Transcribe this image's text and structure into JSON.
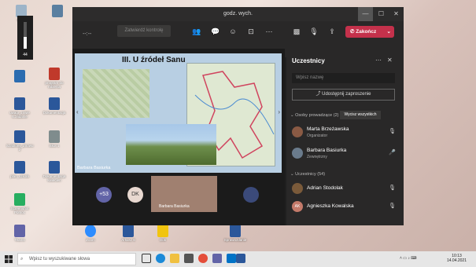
{
  "desktop": {
    "icons": [
      {
        "label": "",
        "color": "#5a7fa0"
      },
      {
        "label": "Kosz",
        "color": "#9db4c8"
      },
      {
        "label": "",
        "color": "#2b6cb0"
      },
      {
        "label": "program do robienia",
        "color": "#c0392b"
      },
      {
        "label": "uwagi_znwie 6.zadanie",
        "color": "#2b579a"
      },
      {
        "label": "Dokumentacja",
        "color": "#2b579a"
      },
      {
        "label": "Szablony_Znowu 2",
        "color": "#2b579a"
      },
      {
        "label": "Skot 1",
        "color": "#7f8c8d"
      },
      {
        "label": "plan_szkola",
        "color": "#2b579a"
      },
      {
        "label": "Dokumentacja kwiecien",
        "color": "#2b579a"
      },
      {
        "label": "Screenshot Pomoc",
        "color": "#27ae60"
      },
      {
        "label": "Zoom",
        "color": "#2d8cff"
      },
      {
        "label": "Teams",
        "color": "#6264a7"
      },
      {
        "label": "Arkusz 6",
        "color": "#2b579a"
      },
      {
        "label": "Dok",
        "color": "#f1c40f"
      },
      {
        "label": "Sprawozdanie",
        "color": "#2b579a"
      }
    ]
  },
  "window": {
    "title": "godz. wych.",
    "minimize": "—",
    "maximize": "☐",
    "close": "✕"
  },
  "toolbar": {
    "timer": "--:--",
    "admit_label": "Zatwierdź kontrolę",
    "leave_label": "Zakończ"
  },
  "slide": {
    "title": "III. U źródeł Sanu",
    "presenter": "Barbara Basiurka"
  },
  "thumbs": {
    "overflow": "+53",
    "initials": "DK",
    "cam_name": "Barbara Basiurka"
  },
  "panel": {
    "title": "Uczestnicy",
    "search_placeholder": "Wpisz nazwę",
    "share_label": "Udostępnij zaproszenie",
    "presenters_header": "Osoby prowadzące (2)",
    "mute_all": "Wycisz wszystkich",
    "attendees_header": "Uczestnicy (54)",
    "presenters": [
      {
        "name": "Marta Brzeżawska",
        "role": "Organizator",
        "color": "#8a5a44"
      },
      {
        "name": "Barbara Basiurka",
        "role": "Zewnętrzny",
        "color": "#6a7b8c"
      }
    ],
    "attendees": [
      {
        "name": "Adrian Stodolak",
        "role": "",
        "color": "#7a5a3a"
      },
      {
        "name": "Agnieszka Kowalska",
        "role": "",
        "color": "#c47a6a",
        "initials": "AK"
      }
    ]
  },
  "taskbar": {
    "search_placeholder": "Wpisz tu wyszukiwane słowa",
    "time": "10:13",
    "date": "14.04.2021"
  }
}
